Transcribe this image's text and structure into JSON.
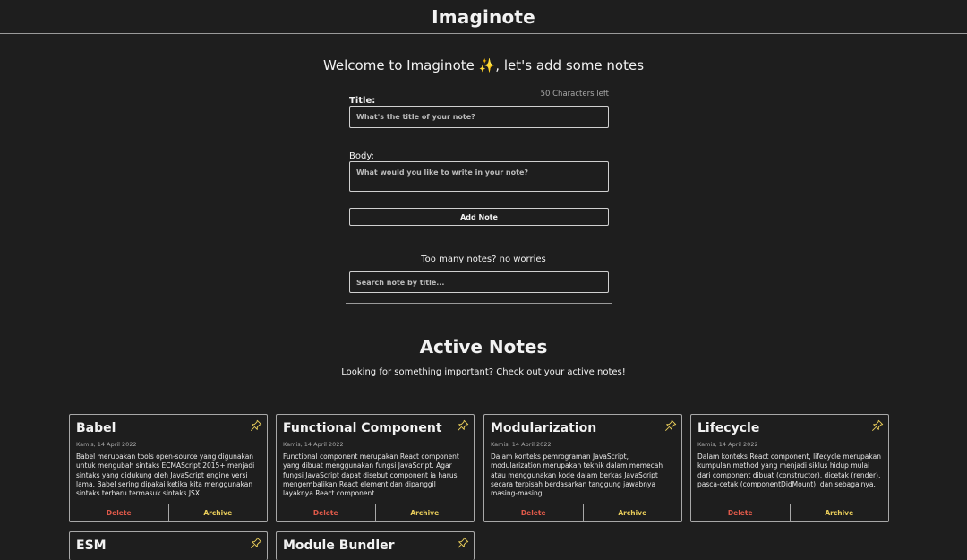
{
  "app": {
    "title": "Imaginote"
  },
  "welcome": {
    "text": "Welcome to Imaginote ✨, let's add some notes"
  },
  "form": {
    "title_label": "Title:",
    "chars_left": "50 Characters left",
    "title_placeholder": "What's the title of your note?",
    "body_label": "Body:",
    "body_placeholder": "What would you like to write in your note?",
    "add_button": "Add Note"
  },
  "search": {
    "caption": "Too many notes? no worries",
    "placeholder": "Search note by title..."
  },
  "active": {
    "title": "Active Notes",
    "subtitle": "Looking for something important? Check out your active notes!"
  },
  "colors": {
    "background": "#1e1e1e",
    "delete": "#e15a4a",
    "archive": "#e8cc5a",
    "pin": "#e8cc5a"
  },
  "notes": [
    {
      "title": "Babel",
      "date": "Kamis, 14 April 2022",
      "body": "Babel merupakan tools open-source yang digunakan untuk mengubah sintaks ECMAScript 2015+ menjadi sintaks yang didukung oleh JavaScript engine versi lama. Babel sering dipakai ketika kita menggunakan sintaks terbaru termasuk sintaks JSX.",
      "delete": "Delete",
      "archive": "Archive",
      "icon": "pin-icon"
    },
    {
      "title": "Functional Component",
      "date": "Kamis, 14 April 2022",
      "body": "Functional component merupakan React component yang dibuat menggunakan fungsi JavaScript. Agar fungsi JavaScript dapat disebut component ia harus mengembalikan React element dan dipanggil layaknya React component.",
      "delete": "Delete",
      "archive": "Archive",
      "icon": "pin-icon"
    },
    {
      "title": "Modularization",
      "date": "Kamis, 14 April 2022",
      "body": "Dalam konteks pemrograman JavaScript, modularization merupakan teknik dalam memecah atau menggunakan kode dalam berkas JavaScript secara terpisah berdasarkan tanggung jawabnya masing-masing.",
      "delete": "Delete",
      "archive": "Archive",
      "icon": "pin-icon"
    },
    {
      "title": "Lifecycle",
      "date": "Kamis, 14 April 2022",
      "body": "Dalam konteks React component, lifecycle merupakan kumpulan method yang menjadi siklus hidup mulai dari component dibuat (constructor), dicetak (render), pasca-cetak (componentDidMount), dan sebagainya.",
      "delete": "Delete",
      "archive": "Archive",
      "icon": "pin-icon"
    },
    {
      "title": "ESM",
      "icon": "pin-icon"
    },
    {
      "title": "Module Bundler",
      "icon": "pin-icon"
    }
  ]
}
